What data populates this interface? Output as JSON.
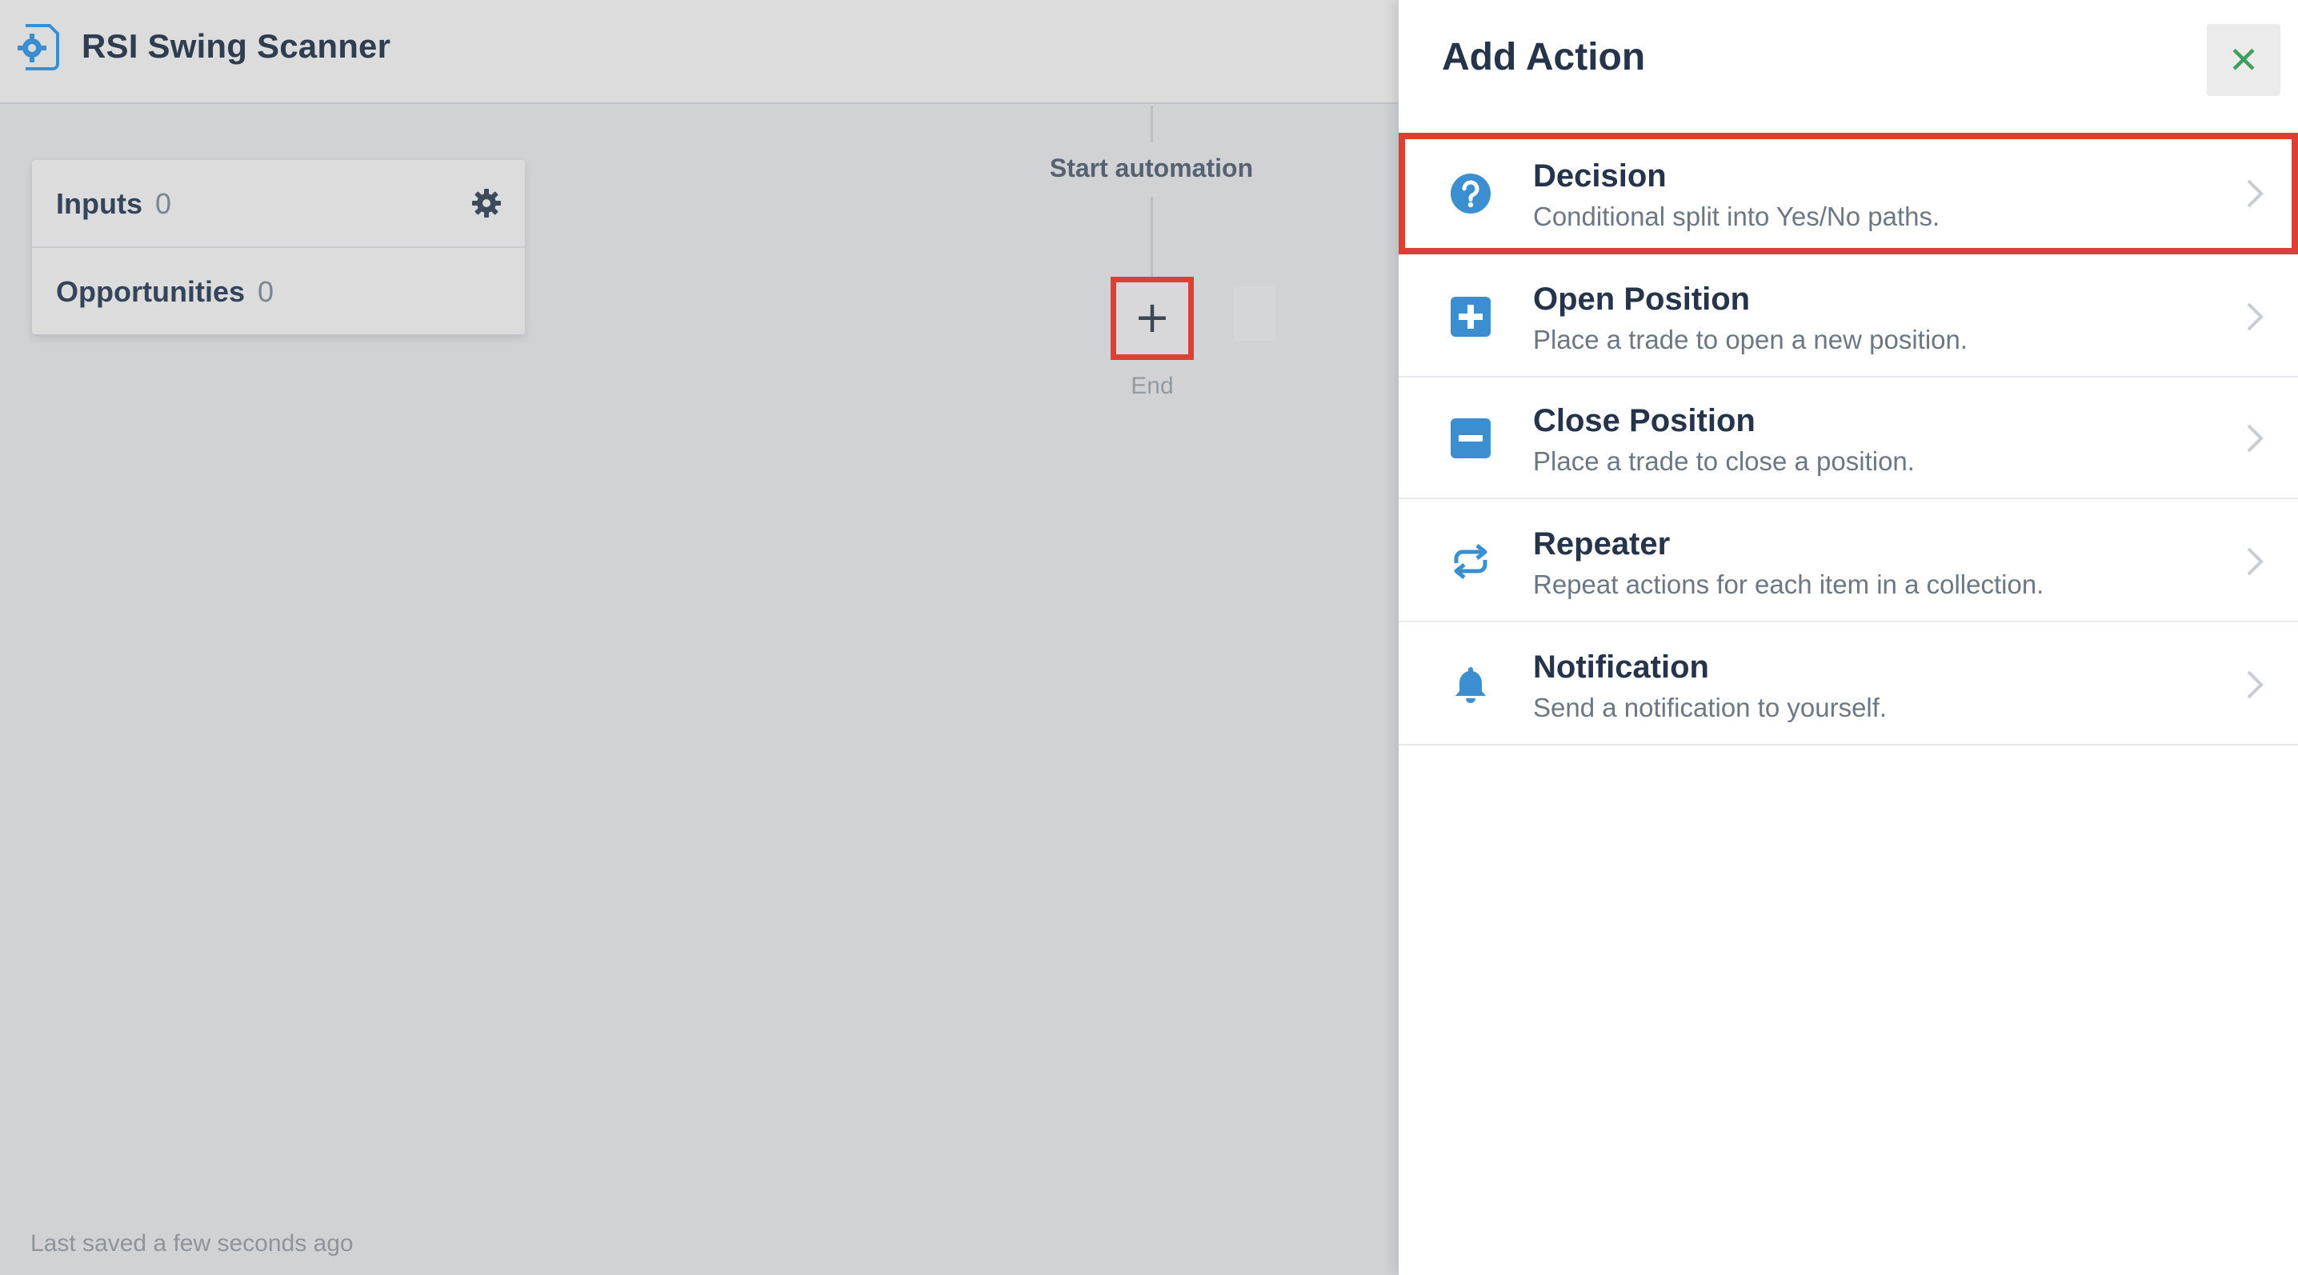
{
  "app": {
    "title": "RSI Swing Scanner",
    "icon": "automation-gear-icon"
  },
  "sidebar_card": {
    "inputs": {
      "label": "Inputs",
      "count": "0"
    },
    "opportunities": {
      "label": "Opportunities",
      "count": "0"
    }
  },
  "flow": {
    "start_label": "Start automation",
    "add_symbol": "+",
    "end_label": "End"
  },
  "status": {
    "saved_text": "Last saved a few seconds ago"
  },
  "panel": {
    "title": "Add Action",
    "close_symbol": "✕",
    "actions": [
      {
        "title": "Decision",
        "description": "Conditional split into Yes/No paths.",
        "icon": "question-circle-icon",
        "selected": true
      },
      {
        "title": "Open Position",
        "description": "Place a trade to open a new position.",
        "icon": "plus-square-icon",
        "selected": false
      },
      {
        "title": "Close Position",
        "description": "Place a trade to close a position.",
        "icon": "minus-square-icon",
        "selected": false
      },
      {
        "title": "Repeater",
        "description": "Repeat actions for each item in a collection.",
        "icon": "repeat-arrows-icon",
        "selected": false
      },
      {
        "title": "Notification",
        "description": "Send a notification to yourself.",
        "icon": "bell-icon",
        "selected": false
      }
    ]
  },
  "colors": {
    "accent_blue": "#3b8fd0",
    "highlight_red": "#df3f33",
    "close_green": "#3f9e5c",
    "heading_dark": "#25344a"
  }
}
